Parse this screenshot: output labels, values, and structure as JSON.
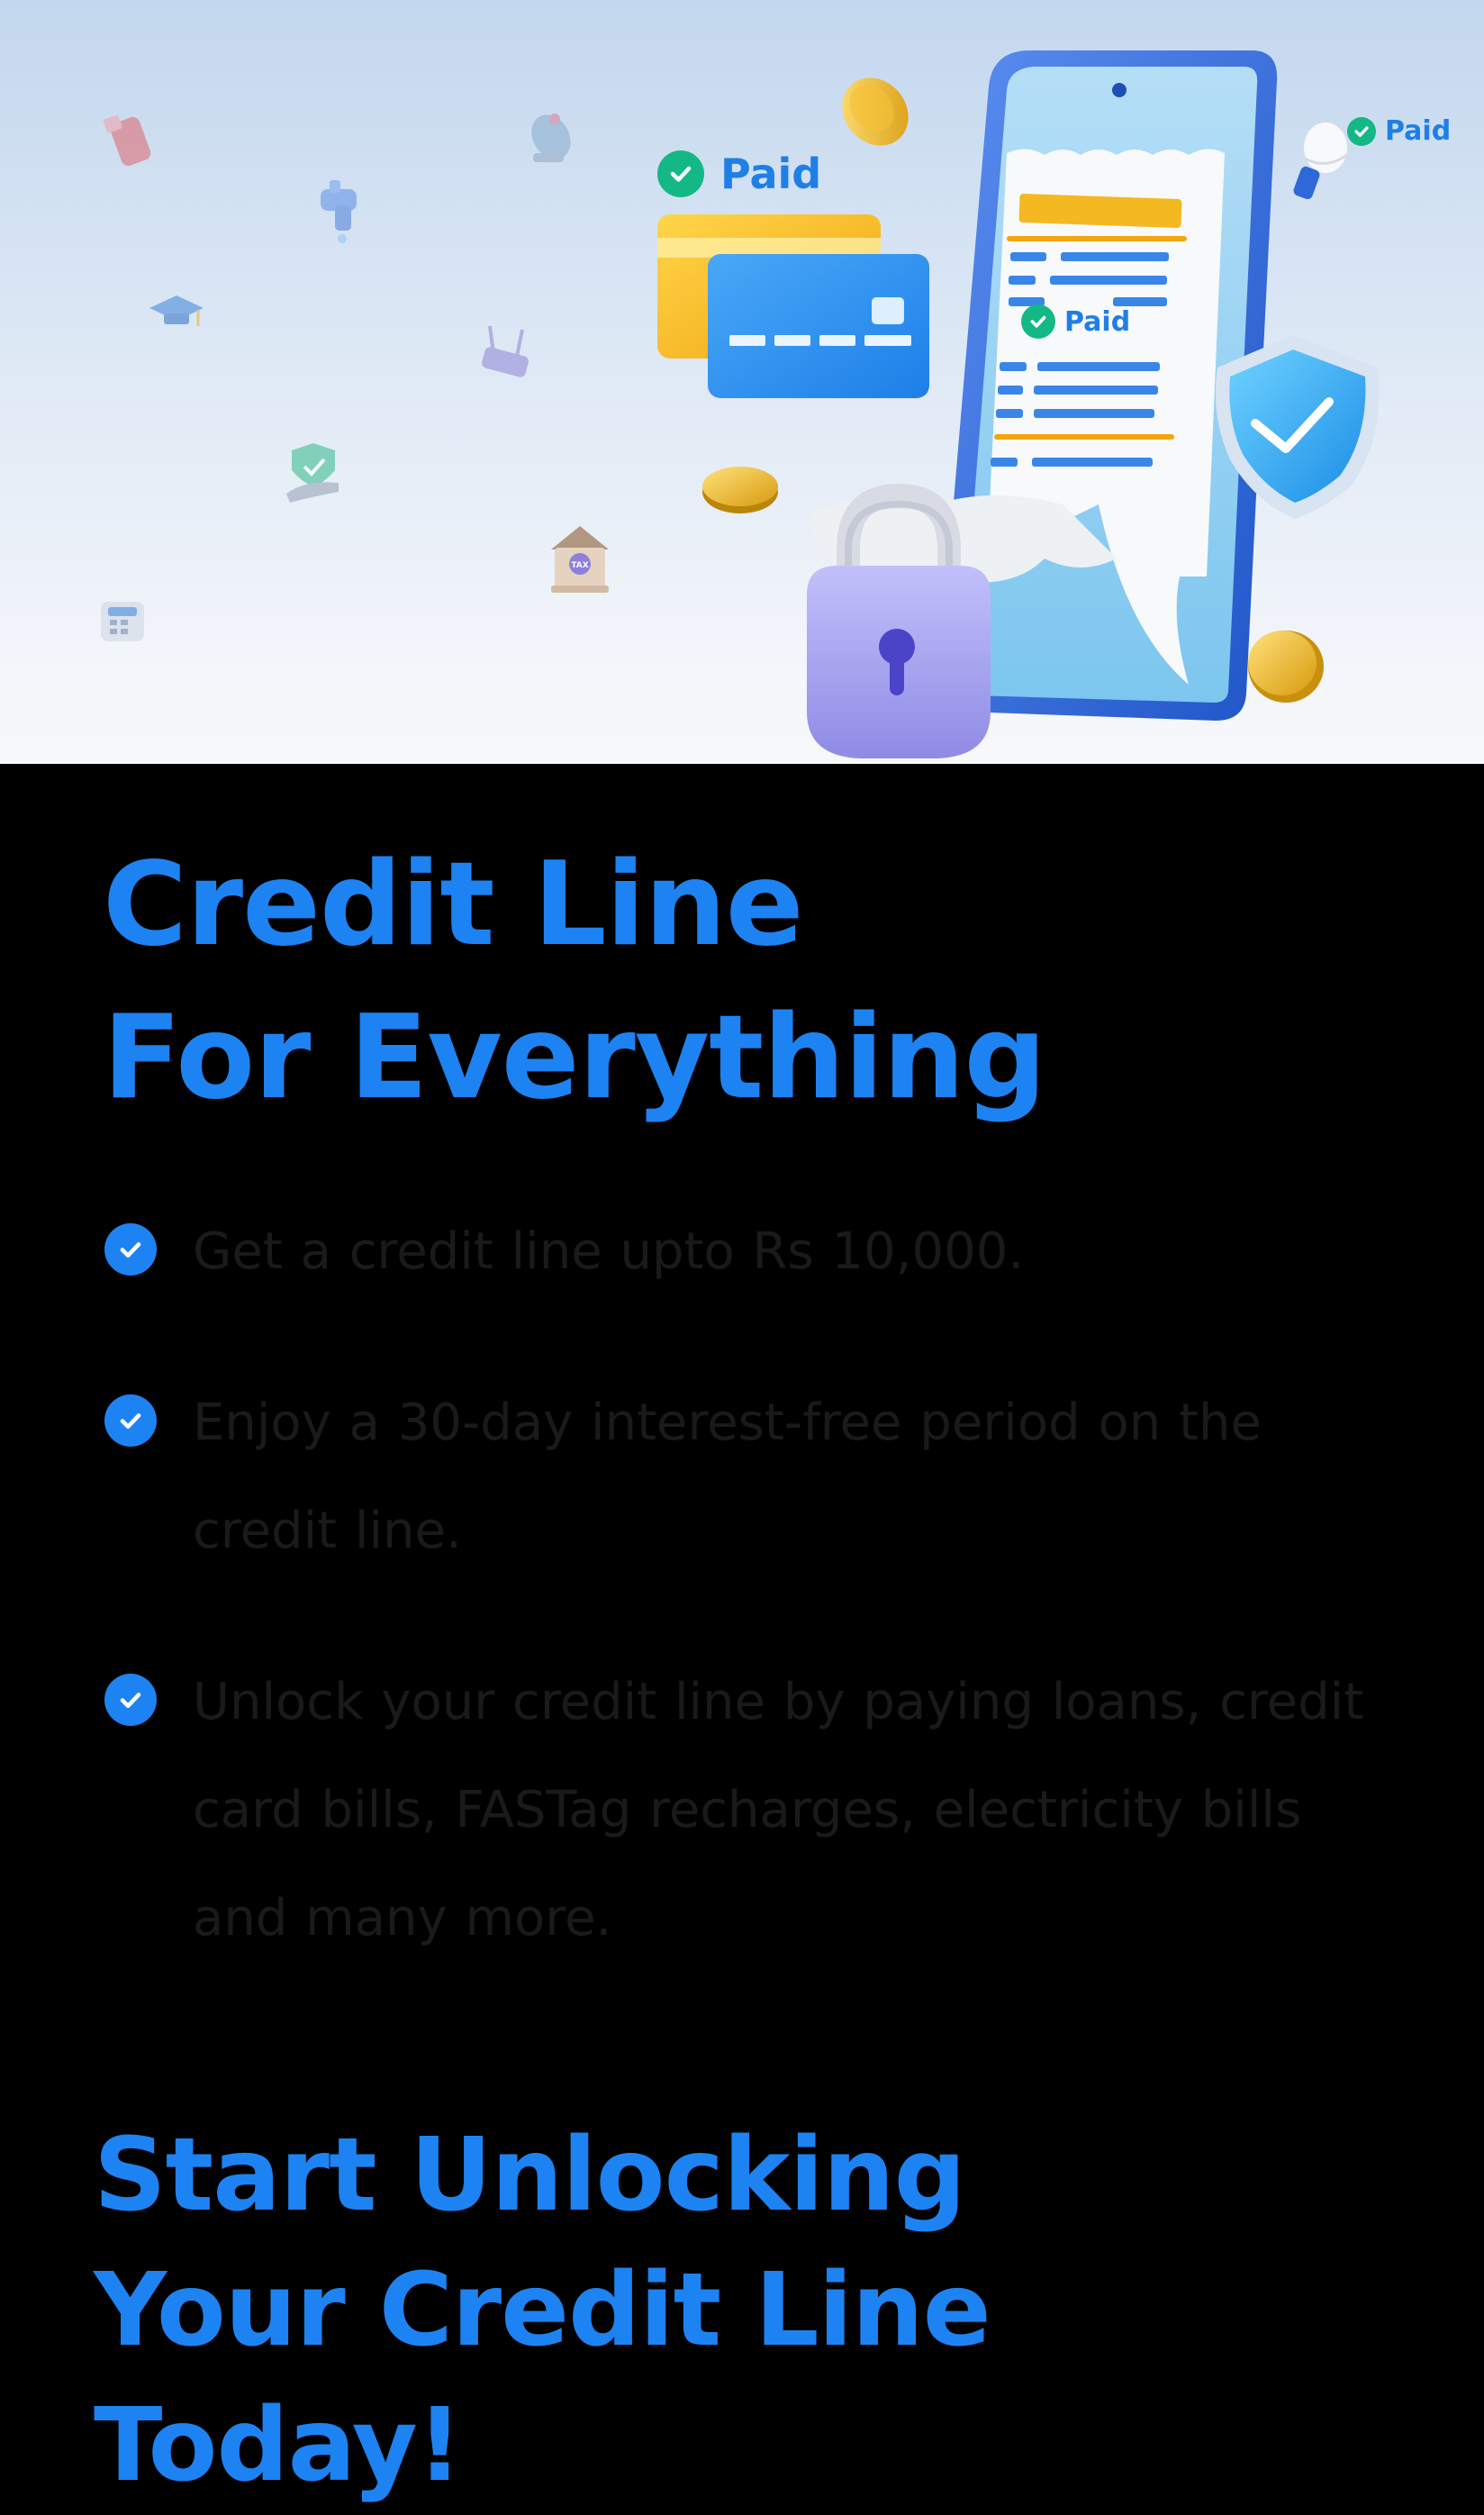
{
  "hero": {
    "paid_labels": [
      "Paid",
      "Paid",
      "Paid"
    ],
    "icons": [
      "usb-icon",
      "satellite-dish-icon",
      "water-tap-icon",
      "graduation-cap-icon",
      "router-icon",
      "shield-hand-icon",
      "tax-house-icon",
      "landline-phone-icon",
      "coin-icon",
      "credit-card-icon",
      "phone-receipt-icon",
      "shield-check-icon",
      "padlock-icon",
      "light-bulb-icon"
    ],
    "tax_label": "TAX",
    "colors": {
      "accent_blue": "#1d83f2",
      "paid_green": "#14b884",
      "card_yellow": "#f4b820",
      "lock_purple": "#a9a7f2"
    }
  },
  "main": {
    "headline_lines": [
      "Credit Line",
      "For Everything"
    ],
    "features": [
      "Get a credit line upto Rs 10,000.",
      "Enjoy a 30-day interest-free period on the credit line.",
      "Unlock your credit line by paying loans, credit card bills, FASTag recharges, electricity bills and many more."
    ],
    "cta_lines": [
      "Start Unlocking",
      "Your Credit Line",
      "Today!"
    ]
  }
}
